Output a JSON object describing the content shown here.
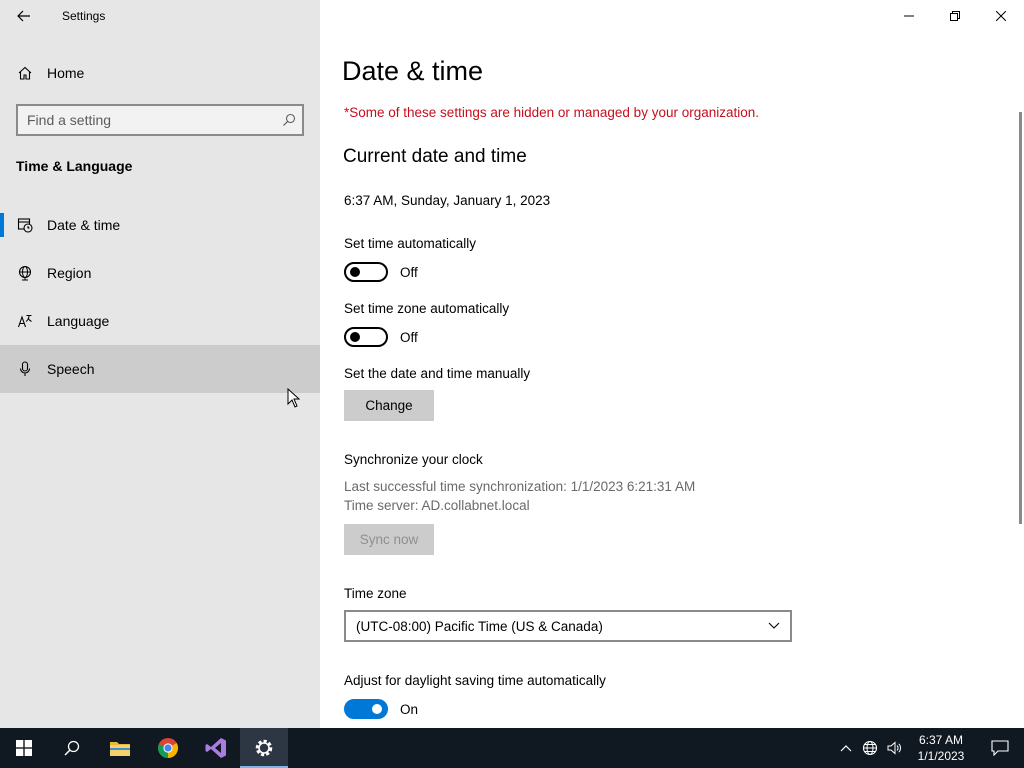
{
  "window": {
    "title": "Settings",
    "controls": [
      "minimize",
      "restore",
      "close"
    ]
  },
  "sidebar": {
    "home_label": "Home",
    "search_placeholder": "Find a setting",
    "section_label": "Time & Language",
    "items": [
      {
        "label": "Date & time",
        "icon": "date-time-icon",
        "active": true
      },
      {
        "label": "Region",
        "icon": "globe-icon",
        "active": false
      },
      {
        "label": "Language",
        "icon": "language-icon",
        "active": false
      },
      {
        "label": "Speech",
        "icon": "microphone-icon",
        "active": false,
        "hovered": true
      }
    ]
  },
  "main": {
    "title": "Date & time",
    "org_notice": "*Some of these settings are hidden or managed by your organization.",
    "current_heading": "Current date and time",
    "current_datetime": "6:37 AM, Sunday, January 1, 2023",
    "set_time_auto": {
      "label": "Set time automatically",
      "state": "Off"
    },
    "set_zone_auto": {
      "label": "Set time zone automatically",
      "state": "Off"
    },
    "manual": {
      "label": "Set the date and time manually",
      "button": "Change"
    },
    "sync": {
      "heading": "Synchronize your clock",
      "last_sync": "Last successful time synchronization: 1/1/2023 6:21:31 AM",
      "server": "Time server: AD.collabnet.local",
      "button": "Sync now"
    },
    "timezone": {
      "label": "Time zone",
      "value": "(UTC-08:00) Pacific Time (US & Canada)"
    },
    "dst": {
      "label": "Adjust for daylight saving time automatically",
      "state": "On"
    }
  },
  "taskbar": {
    "apps": [
      "start-icon",
      "search-icon",
      "file-explorer-icon",
      "chrome-icon",
      "visual-studio-icon",
      "settings-icon"
    ],
    "clock_time": "6:37 AM",
    "clock_date": "1/1/2023"
  },
  "colors": {
    "accent": "#0078d7",
    "warning": "#c50f1f",
    "taskbar": "#101822",
    "sidebar": "#e6e6e6"
  }
}
